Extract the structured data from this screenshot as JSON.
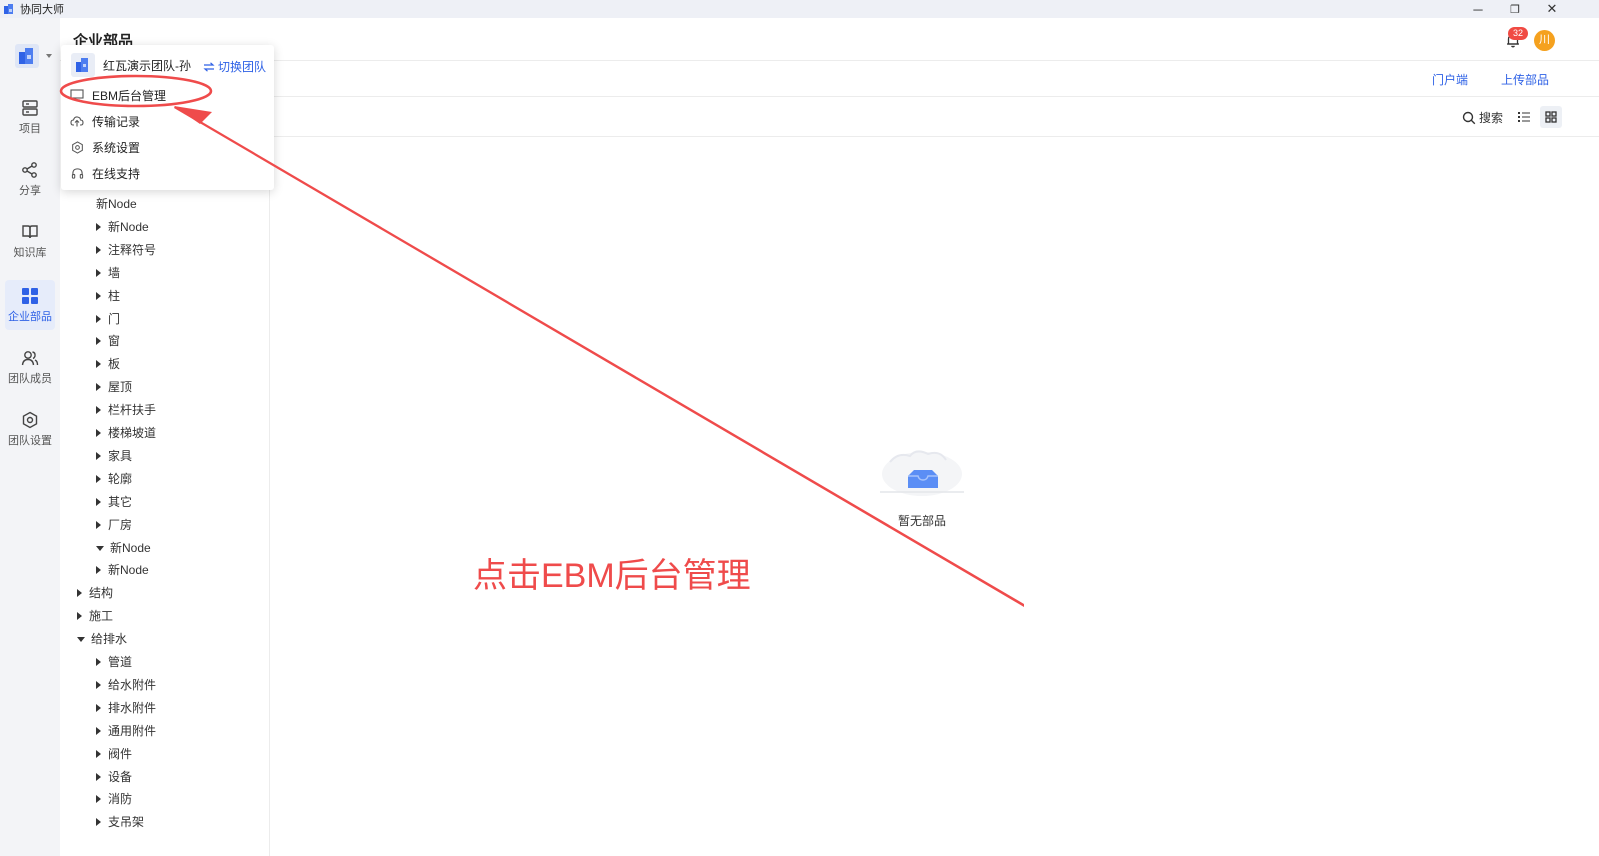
{
  "window": {
    "app_name": "协同大师",
    "minimize_glyph": "─",
    "restore_glyph": "❐",
    "close_glyph": "✕"
  },
  "rail": {
    "items": [
      {
        "label": "项目",
        "icon": "project-icon"
      },
      {
        "label": "分享",
        "icon": "share-icon"
      },
      {
        "label": "知识库",
        "icon": "book-icon"
      },
      {
        "label": "企业部品",
        "icon": "grid-icon",
        "active": true
      },
      {
        "label": "团队成员",
        "icon": "team-members-icon"
      },
      {
        "label": "团队设置",
        "icon": "team-settings-icon"
      }
    ]
  },
  "header": {
    "title": "企业部品",
    "notification_count": "32",
    "avatar_text": "川"
  },
  "toolbar": {
    "portal_link": "门户端",
    "upload_link": "上传部品",
    "search_label": "搜索"
  },
  "menu": {
    "team_name": "红瓦演示团队-孙",
    "switch_team": "切换团队",
    "items": [
      {
        "label": "EBM后台管理",
        "icon": "monitor-icon"
      },
      {
        "label": "传输记录",
        "icon": "cloud-transfer-icon"
      },
      {
        "label": "系统设置",
        "icon": "gear-icon"
      },
      {
        "label": "在线支持",
        "icon": "headset-icon"
      }
    ]
  },
  "tree": {
    "items": [
      {
        "label": "新Node",
        "level": 1,
        "caret": "none"
      },
      {
        "label": "新Node",
        "level": 1,
        "caret": "right"
      },
      {
        "label": "注释符号",
        "level": 1,
        "caret": "right"
      },
      {
        "label": "墙",
        "level": 1,
        "caret": "right"
      },
      {
        "label": "柱",
        "level": 1,
        "caret": "right"
      },
      {
        "label": "门",
        "level": 1,
        "caret": "right"
      },
      {
        "label": "窗",
        "level": 1,
        "caret": "right"
      },
      {
        "label": "板",
        "level": 1,
        "caret": "right"
      },
      {
        "label": "屋顶",
        "level": 1,
        "caret": "right"
      },
      {
        "label": "栏杆扶手",
        "level": 1,
        "caret": "right"
      },
      {
        "label": "楼梯坡道",
        "level": 1,
        "caret": "right"
      },
      {
        "label": "家具",
        "level": 1,
        "caret": "right"
      },
      {
        "label": "轮廓",
        "level": 1,
        "caret": "right"
      },
      {
        "label": "其它",
        "level": 1,
        "caret": "right"
      },
      {
        "label": "厂房",
        "level": 1,
        "caret": "right"
      },
      {
        "label": "新Node",
        "level": 1,
        "caret": "down"
      },
      {
        "label": "新Node",
        "level": 1,
        "caret": "right"
      },
      {
        "label": "结构",
        "level": 0,
        "caret": "right"
      },
      {
        "label": "施工",
        "level": 0,
        "caret": "right"
      },
      {
        "label": "给排水",
        "level": 0,
        "caret": "down"
      },
      {
        "label": "管道",
        "level": 1,
        "caret": "right"
      },
      {
        "label": "给水附件",
        "level": 1,
        "caret": "right"
      },
      {
        "label": "排水附件",
        "level": 1,
        "caret": "right"
      },
      {
        "label": "通用附件",
        "level": 1,
        "caret": "right"
      },
      {
        "label": "阀件",
        "level": 1,
        "caret": "right"
      },
      {
        "label": "设备",
        "level": 1,
        "caret": "right"
      },
      {
        "label": "消防",
        "level": 1,
        "caret": "right"
      },
      {
        "label": "支吊架",
        "level": 1,
        "caret": "right"
      }
    ]
  },
  "empty_state": {
    "text": "暂无部品"
  },
  "annotation": {
    "text": "点击EBM后台管理",
    "color": "#ef4b4b"
  },
  "colors": {
    "accent": "#2f62e6",
    "badge": "#f04a43",
    "avatar": "#f5a11e"
  }
}
